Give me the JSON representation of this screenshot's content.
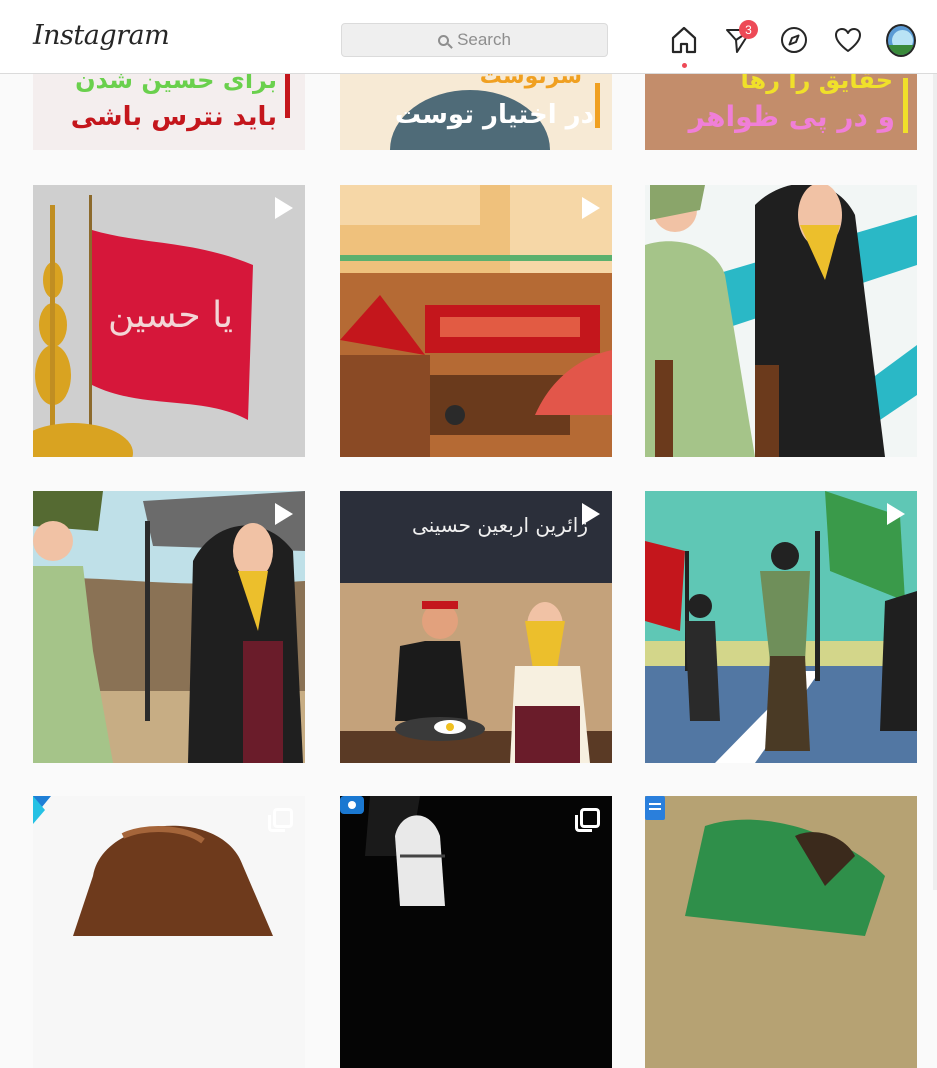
{
  "header": {
    "logo": "Instagram",
    "search_placeholder": "Search",
    "messages_badge": "3"
  },
  "icons": [
    "home-icon",
    "direct-icon",
    "explore-icon",
    "activity-heart-icon",
    "profile-avatar"
  ],
  "posts": {
    "row0": [
      {
        "lines": [
          "برای حسین شدن",
          "باید نترس باشی"
        ]
      },
      {
        "lines": [
          "سرنوشت",
          "در اختیار توست"
        ]
      },
      {
        "lines": [
          "حقایق را رها",
          "و در پی ظواهر"
        ]
      }
    ],
    "row1": [
      {
        "flag_text": "یا حسین",
        "type": "video"
      },
      {
        "type": "video"
      },
      {
        "type": "video"
      }
    ],
    "row2": [
      {
        "type": "video"
      },
      {
        "caption": "زائرین اربعین حسینی",
        "type": "video"
      },
      {
        "type": "video"
      }
    ],
    "row3": [
      {
        "type": "carousel"
      },
      {
        "type": "carousel"
      },
      {
        "type": "post"
      }
    ]
  },
  "colors": {
    "accent": "#ed4956",
    "border": "#dbdbdb",
    "background": "#fafafa"
  }
}
